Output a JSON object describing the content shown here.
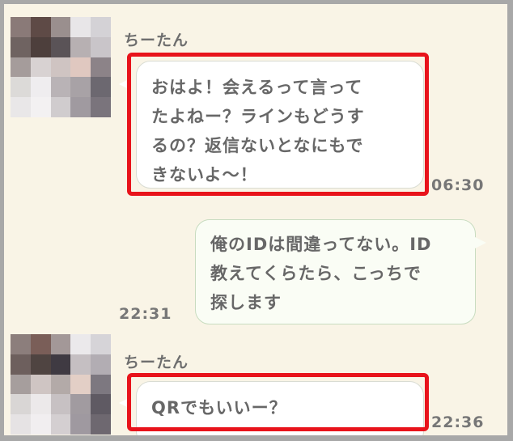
{
  "colors": {
    "frame_background": "#f9f4e6",
    "highlight": "#e8131b",
    "incoming_bubble": "#ffffff",
    "outgoing_bubble": "#fafdf5"
  },
  "messages": [
    {
      "direction": "incoming",
      "sender": "ちーたん",
      "lines": [
        "おはよ！会えるって言って",
        "たよねー？ラインもどうす",
        "るの？返信ないとなにもで",
        "きないよ〜！"
      ],
      "time": "06:30",
      "highlighted": true
    },
    {
      "direction": "outgoing",
      "lines": [
        "俺のIDは間違ってない。ID",
        "教えてくらたら、こっちで",
        "探します"
      ],
      "time": "22:31"
    },
    {
      "direction": "incoming",
      "sender": "ちーたん",
      "lines": [
        "QRでもいいー？"
      ],
      "time": "22:36",
      "highlighted": true
    }
  ],
  "avatar_icon": "pixelated-avatar-icon"
}
